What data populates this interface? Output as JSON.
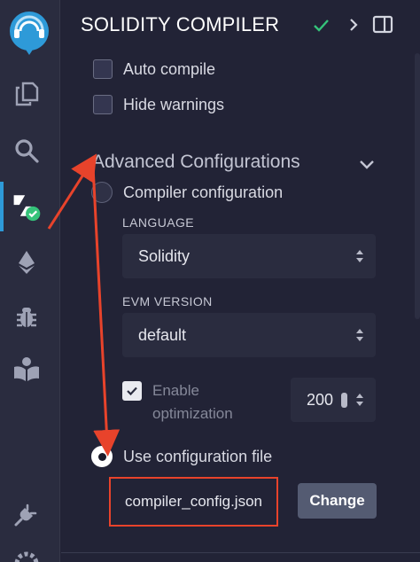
{
  "header": {
    "title": "SOLIDITY COMPILER"
  },
  "options": {
    "auto_compile": "Auto compile",
    "hide_warnings": "Hide warnings"
  },
  "advanced": {
    "title": "Advanced Configurations",
    "compiler_configuration": "Compiler configuration",
    "language_label": "LANGUAGE",
    "language_value": "Solidity",
    "evm_label": "EVM VERSION",
    "evm_value": "default",
    "enable_optimization": "Enable optimization",
    "optimization_runs": "200",
    "use_config_file": "Use configuration file",
    "config_file": "compiler_config.json",
    "change_button": "Change"
  },
  "colors": {
    "brand": "#2e9ad8",
    "success": "#35c37a",
    "annotation": "#e8432b"
  }
}
